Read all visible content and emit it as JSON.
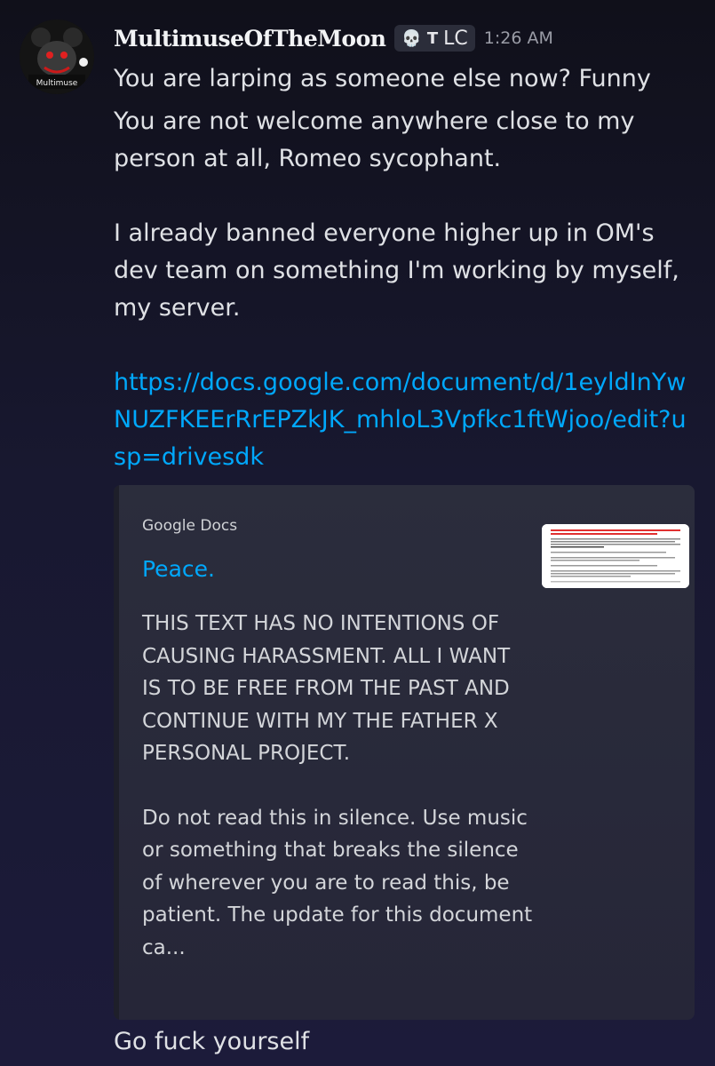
{
  "message": {
    "username": "MultimuseOfTheMoon",
    "tag_icon": "skull",
    "tag_text_1": "T",
    "tag_text_2": "ᒪC",
    "timestamp": "1:26 AM",
    "avatar_label": "Multimuse",
    "line1": "You are larping as someone else now? Funny",
    "paragraph1": "You are not welcome anywhere close to my person at all, Romeo sycophant.",
    "paragraph2": "I already banned everyone higher up in OM's dev team on something I'm working by myself, my server.",
    "link": "https://docs.google.com/document/d/1eyldInYwNUZFKEErRrEPZkJK_mhloL3Vpfkc1ftWjoo/edit?usp=drivesdk",
    "last_line": "Go fuck yourself"
  },
  "embed": {
    "provider": "Google Docs",
    "title": "Peace.",
    "description_1": "THIS TEXT HAS NO INTENTIONS OF CAUSING HARASSMENT. ALL I WANT IS TO BE FREE FROM THE PAST AND CONTINUE WITH MY THE FATHER X PERSONAL PROJECT.",
    "description_2": "Do not read this in silence. Use music or something that breaks the silence of wherever you are to read this, be patient.  The update for this document ca..."
  },
  "colors": {
    "link": "#00a8fc",
    "background_top": "#10101a",
    "background_bottom": "#1c1b3a",
    "embed_bg": "#2b2d3a"
  }
}
